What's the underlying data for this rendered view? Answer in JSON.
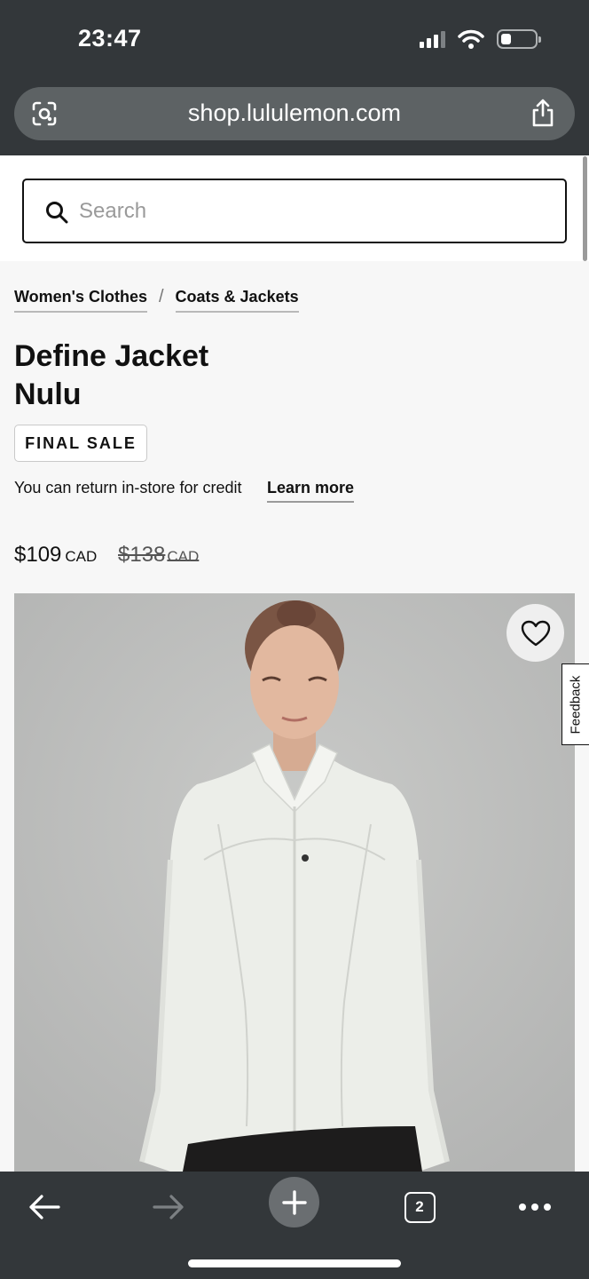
{
  "status_bar": {
    "time": "23:47"
  },
  "browser": {
    "url": "shop.lululemon.com",
    "open_tabs": "2"
  },
  "search": {
    "placeholder": "Search"
  },
  "breadcrumb": [
    {
      "label": "Women's Clothes"
    },
    {
      "label": "Coats & Jackets"
    }
  ],
  "breadcrumb_separator": "/",
  "product": {
    "title_line1": "Define Jacket",
    "title_line2": "Nulu",
    "badge": "FINAL SALE",
    "return_text": "You can return in-store for credit",
    "learn_more": "Learn more",
    "price": "$109",
    "price_currency": "CAD",
    "original_price": "$138",
    "original_currency": "CAD"
  },
  "feedback_label": "Feedback",
  "icons": {
    "lens": "camera-search-icon",
    "share": "share-icon",
    "search": "search-icon",
    "wishlist": "heart-icon",
    "back": "arrow-left-icon",
    "forward": "arrow-right-icon",
    "new_tab": "plus-icon",
    "more": "ellipsis-icon"
  },
  "colors": {
    "chrome": "#33373a",
    "image_background": "#bdbebd",
    "jacket": "#eceee9"
  }
}
